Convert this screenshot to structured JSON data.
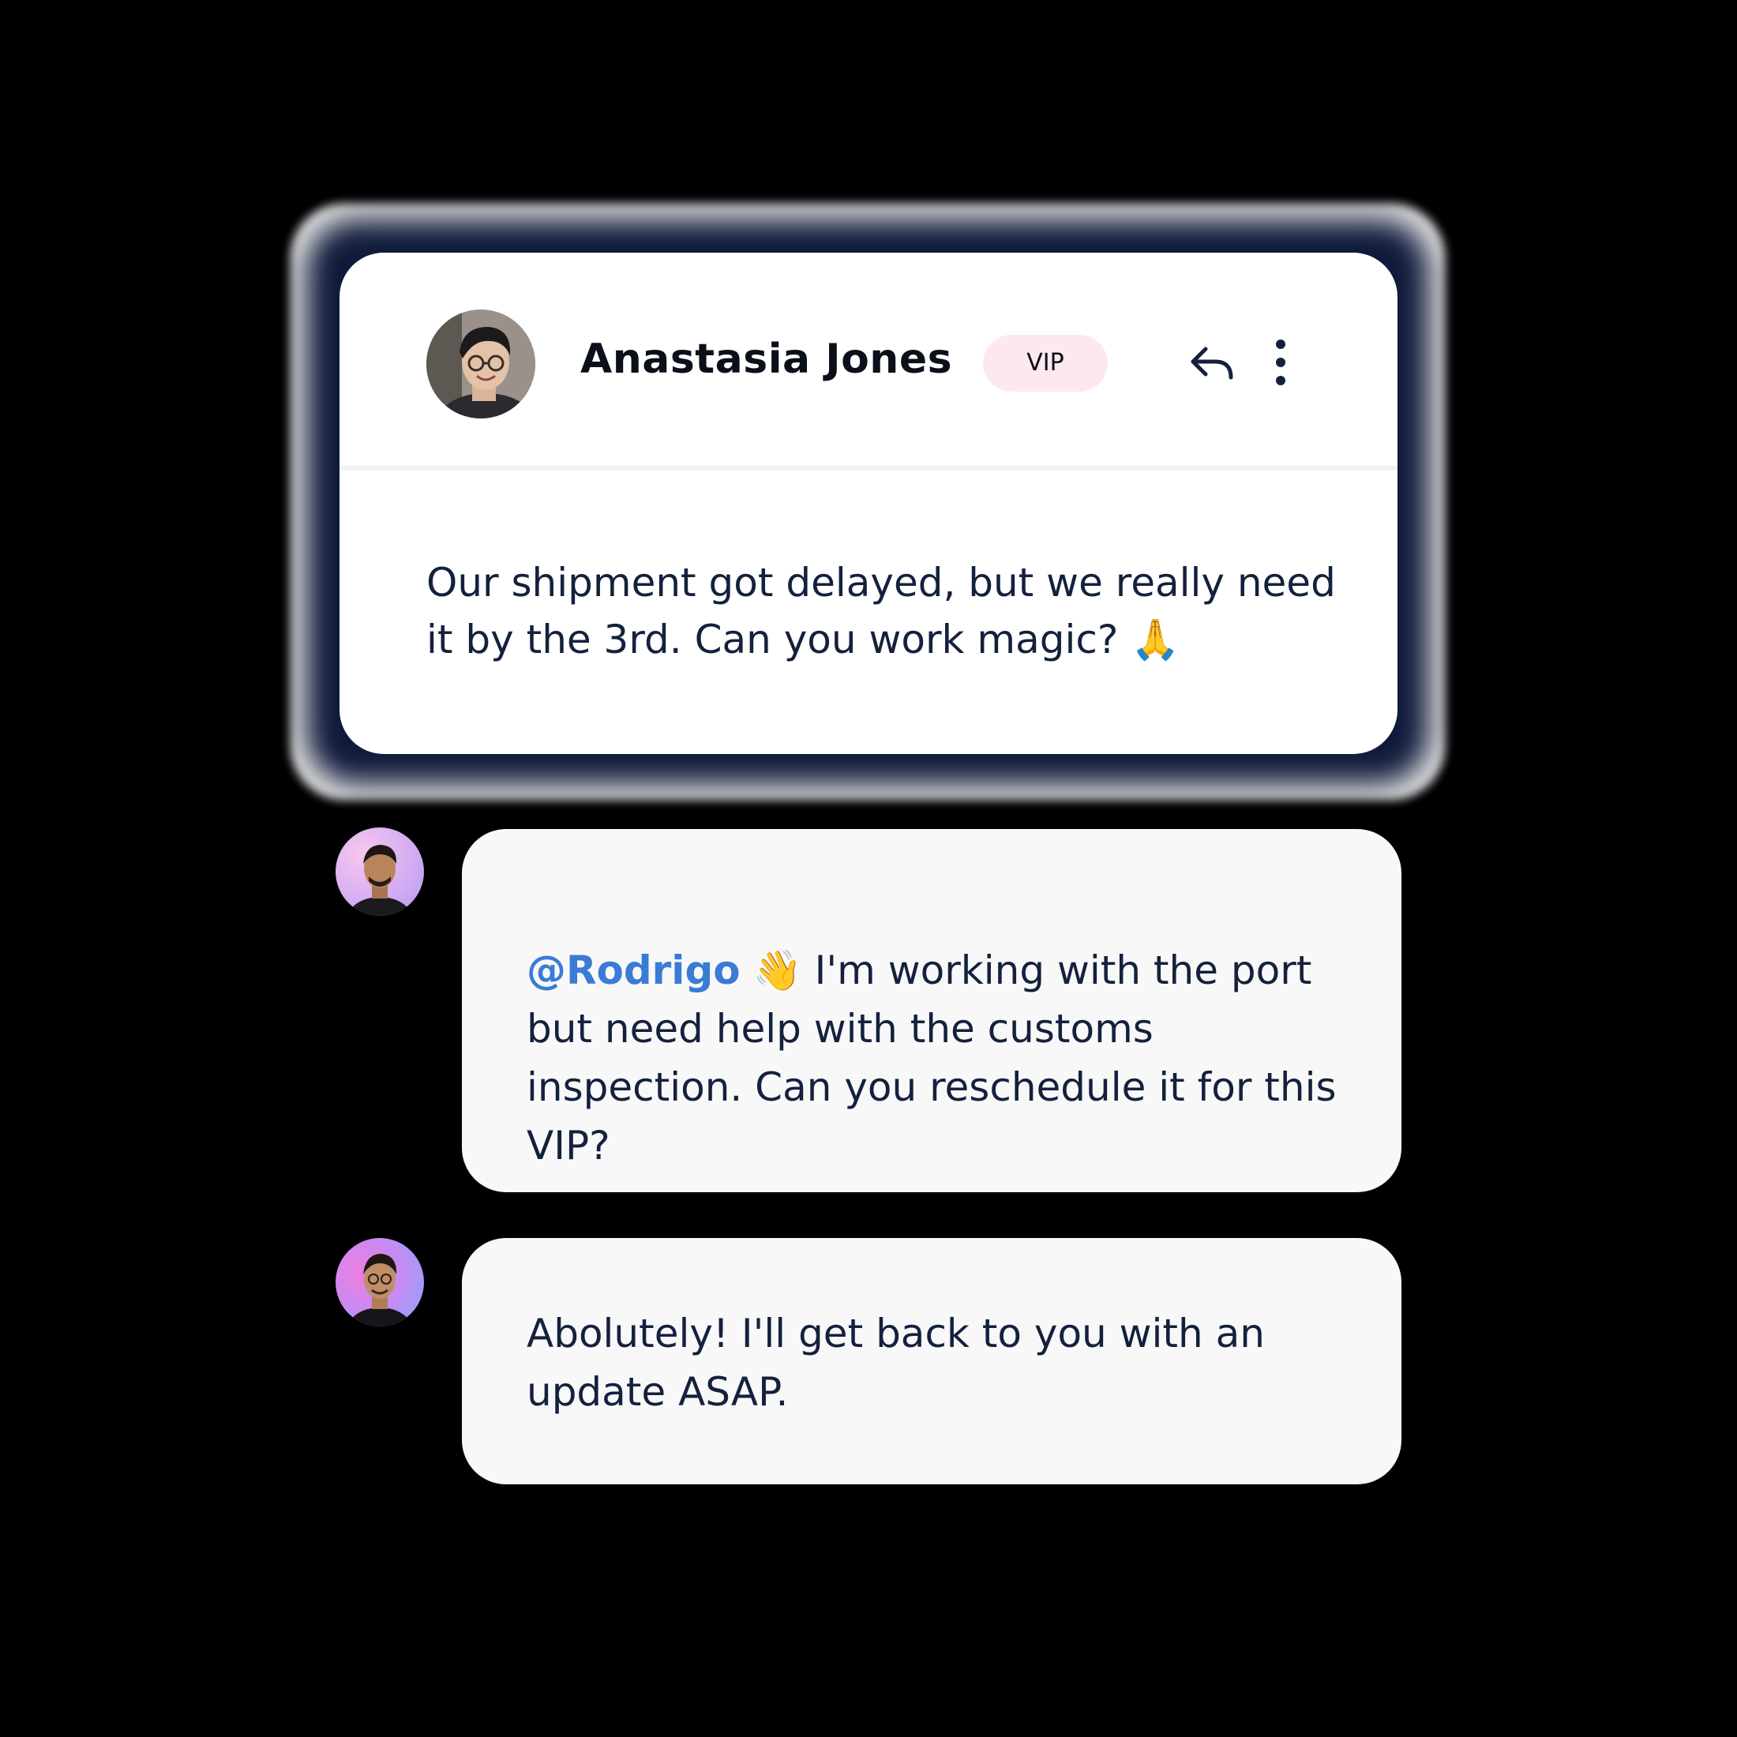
{
  "customer_card": {
    "sender_name": "Anastasia Jones",
    "badge": "VIP",
    "message": "Our shipment got delayed, but we really need it by the 3rd. Can you work magic? 🙏",
    "actions": {
      "reply_icon": "reply-icon",
      "more_icon": "more-vertical-icon"
    }
  },
  "thread": [
    {
      "mention": "@Rodrigo",
      "emoji": "👋",
      "text": " I'm working with the port but need help with the customs inspection. Can you reschedule it for this VIP?"
    },
    {
      "text": "Abolutely! I'll get back to you with an update ASAP."
    }
  ],
  "colors": {
    "background": "#000000",
    "card": "#ffffff",
    "bubble": "#f8f8f9",
    "text": "#14213d",
    "mention": "#3a7bd5",
    "vip_badge": "#fde8ee"
  }
}
